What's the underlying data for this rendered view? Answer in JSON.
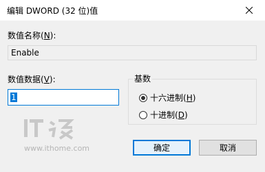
{
  "window": {
    "title": "编辑 DWORD (32 位)值"
  },
  "value_name": {
    "label_pre": "数值名称(",
    "label_key": "N",
    "label_post": "):",
    "value": "Enable"
  },
  "value_data": {
    "label_pre": "数值数据(",
    "label_key": "V",
    "label_post": "):",
    "value": "1"
  },
  "base": {
    "legend": "基数",
    "options": [
      {
        "pre": "十六进制(",
        "key": "H",
        "post": ")",
        "selected": true
      },
      {
        "pre": "十进制(",
        "key": "D",
        "post": ")",
        "selected": false
      }
    ]
  },
  "watermark": {
    "logo_text": "IT之家",
    "url": "www.ithome.com"
  },
  "buttons": {
    "ok": "确定",
    "cancel": "取消"
  },
  "colors": {
    "accent": "#0078d7",
    "window_bg": "#f0f0f0"
  }
}
